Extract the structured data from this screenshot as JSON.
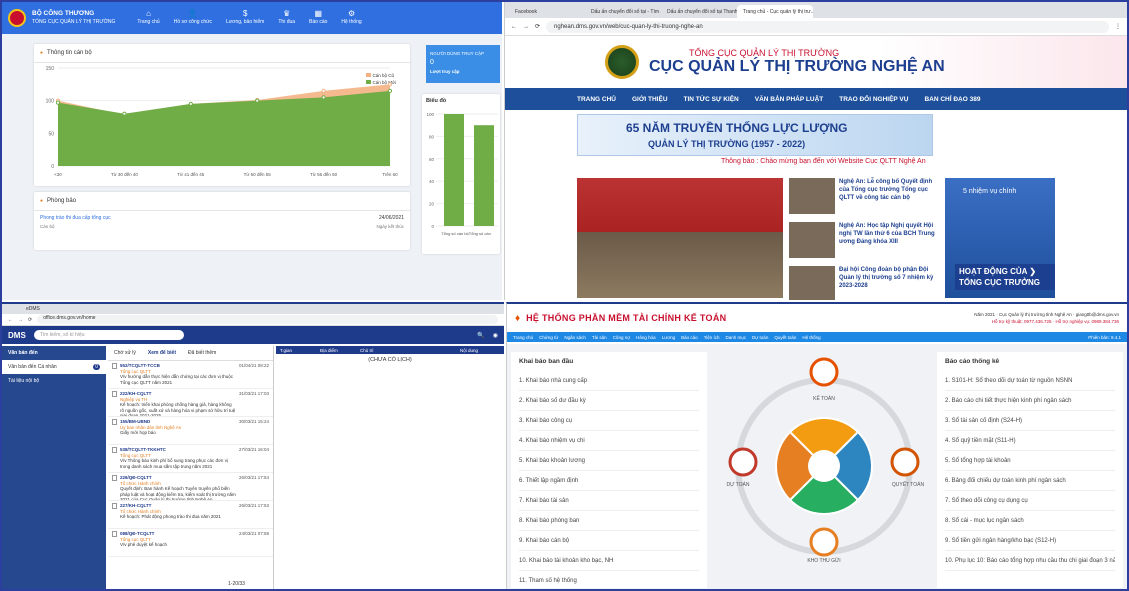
{
  "q1": {
    "brand_title": "BỘ CÔNG THƯƠNG",
    "brand_sub": "TỔNG CỤC QUẢN LÝ THỊ TRƯỜNG",
    "nav": [
      {
        "icon": "⌂",
        "label": "Trang chủ"
      },
      {
        "icon": "👤",
        "label": "Hồ sơ công chức"
      },
      {
        "icon": "$",
        "label": "Lương, bảo hiểm"
      },
      {
        "icon": "♛",
        "label": "Thi đua"
      },
      {
        "icon": "▦",
        "label": "Báo cáo"
      },
      {
        "icon": "⚙",
        "label": "Hệ thống"
      }
    ],
    "info_title": "Thông tin cán bộ",
    "side_title": "NGƯỜI DÙNG TRUY CẬP",
    "side_value": "0",
    "side_sub": "Lượt truy cập",
    "side_chart_title": "Biểu đồ",
    "side_chart_caption": "Tổng số cán bộTổng số cán",
    "notice_title": "Phòng bảo",
    "notice_item": "Phong trào thi đua cấp tổng cục",
    "notice_date": "24/06/2021",
    "notice_org": "Cán bộ",
    "notice_author": "Ngày kết thúc"
  },
  "chart_data": [
    {
      "type": "area",
      "title": "",
      "categories": [
        "<30",
        "Từ 30 đến 40",
        "Từ 41 đến 45",
        "Từ 50 đến 55",
        "Từ 56 đến 60",
        "Trên 60"
      ],
      "ylim": [
        0,
        150
      ],
      "yticks": [
        0,
        50,
        100,
        150
      ],
      "series": [
        {
          "name": "Cán bộ Cũ",
          "color": "#f4b183",
          "values": [
            100,
            78,
            95,
            101,
            115,
            125
          ]
        },
        {
          "name": "Cán bộ Mới",
          "color": "#70ad47",
          "values": [
            97,
            80,
            95,
            100,
            105,
            115
          ]
        }
      ]
    },
    {
      "type": "bar",
      "categories": [
        "Tổng số cán bộ",
        "Tổng số cán"
      ],
      "ylim": [
        0,
        100
      ],
      "yticks": [
        0,
        20,
        40,
        60,
        80,
        100
      ],
      "values": [
        100,
        90
      ]
    }
  ],
  "q2": {
    "tabs": [
      "Facebook",
      "Dấu ấn chuyển đổi số tại - Tìm ...",
      "Dấu ấn chuyển đổi số tại Thanh...",
      "Trang chủ - Cục quản lý thị trư..."
    ],
    "url": "nghean.dms.gov.vn/web/cuc-quan-ly-thi-truong-nghe-an",
    "header_top": "TỔNG CỤC QUẢN LÝ THỊ TRƯỜNG",
    "header_main": "CỤC QUẢN LÝ THỊ TRƯỜNG NGHỆ AN",
    "nav": [
      "TRANG CHỦ",
      "GIỚI THIỆU",
      "TIN TỨC SỰ KIỆN",
      "VĂN BẢN PHÁP LUẬT",
      "TRAO ĐỔI NGHIỆP VỤ",
      "BAN CHỈ ĐẠO 389"
    ],
    "banner_line1": "65 NĂM TRUYỀN THỐNG LỰC LƯỢNG",
    "banner_line2": "QUẢN LÝ THỊ TRƯỜNG (1957 - 2022)",
    "notice": "Thông báo : Chào mừng bạn đến với Website Cục QLTT Nghệ An",
    "news": [
      "Nghệ An: Lễ công bố Quyết định của Tổng cục trưởng Tổng cục QLTT về công tác cán bộ",
      "Nghệ An: Học tập Nghị quyết Hội nghị TW lần thứ 6 của BCH Trung ương Đảng khóa XIII",
      "Đại hội Công đoàn bộ phận Đội Quản lý thị trường số 7 nhiệm kỳ 2023-2028"
    ],
    "promo_title": "5 nhiệm vụ chính",
    "promo_button": "HOẠT ĐỘNG CỦA ❯ TỔNG CỤC TRƯỞNG"
  },
  "q3": {
    "tab": "eDMS",
    "url": "office.dms.gov.vn/home",
    "logo": "DMS",
    "search_placeholder": "Tìm kiếm, số kí hiệu",
    "side": [
      "Văn bản đến",
      "Văn bản đến Cá nhân",
      "Tài liệu nội bộ"
    ],
    "side_badge": "0",
    "list_tabs": [
      "Chờ xử lý",
      "Xem để biết",
      "Đã biết thêm"
    ],
    "grid_headers": [
      "T.gian",
      "Địa điểm",
      "Chủ trì",
      "Nội dung"
    ],
    "grid_empty": "(CHƯA CÓ LỊCH)",
    "pager": "1-20/33",
    "items": [
      {
        "num": "552/TCQLTT-TCCB",
        "org": "Tổng cục QLTT",
        "txt": "V/v hướng dẫn thực hiện dẫn chứng tại các đơn vị thuộc Tổng cục QLTT năm 2021",
        "dt": "01/04/21 08:22"
      },
      {
        "num": "222/KH-CQLTT",
        "org": "Nghiệp vụ TH",
        "txt": "Kế hoạch: triển khai phòng chống hàng giả, hàng không rõ nguồn gốc, xuất xứ và hàng hóa vi phạm sở hữu trí tuệ giai đoạn 2021-2025",
        "dt": "31/03/21 17:03"
      },
      {
        "num": "155/BM-UBND",
        "org": "Ủy ban nhân dân tỉnh Nghệ An",
        "txt": "Giấy mời họp báo",
        "dt": "30/03/21 15:24"
      },
      {
        "num": "538/TCQLTT-TKKHTC",
        "org": "Tổng cục QLTT",
        "txt": "V/v Thông báo kinh phí bổ sung trang phục các đơn vị trong danh sách mua sắm tập trung năm 2021",
        "dt": "27/03/21 16:04"
      },
      {
        "num": "226/QĐ-CQLTT",
        "org": "Tổ chức Hành chính",
        "txt": "Quyết định: Ban hành Kế hoạch Tuyên truyền phổ biến pháp luật và hoạt động kiểm tra, kiểm soát thị trường năm 2021 của Cục Quản lý thị trường tỉnh Nghệ An",
        "dt": "26/03/21 17:54"
      },
      {
        "num": "227/KH-CQLTT",
        "org": "Tổ chức Hành chính",
        "txt": "Kế hoạch: Phát động phong trào thi đua năm 2021",
        "dt": "26/03/21 17:53"
      },
      {
        "num": "088/QĐ-TCQLTT",
        "org": "Tổng cục QLTT",
        "txt": "V/v phê duyệt kế hoạch",
        "dt": "24/03/21 07:59"
      }
    ]
  },
  "q4": {
    "title": "HỆ THỐNG PHẦN MỀM TÀI CHÍNH KẾ TOÁN",
    "year": "Năm 2021",
    "org": "Cục Quản lý thị trường tỉnh Nghệ An",
    "user": "giangttb@dms.gov.vn",
    "hotline1": "Hỗ trợ kỹ thuật: 0977.436.726",
    "hotline2": "Hỗ trợ nghiệp vụ: 0989.384.736",
    "menu": [
      "Trang chủ",
      "Chứng từ",
      "Ngân sách",
      "Tài sản",
      "Công nợ",
      "Hàng hóa",
      "Lương",
      "Báo cáo",
      "Tiện ích",
      "Danh mục",
      "Dự toán",
      "Quyết toán",
      "Hệ thống"
    ],
    "version": "Phiên bản: 9.4.1",
    "left_title": "Khai báo ban đầu",
    "left_items": [
      "1. Khai báo nhà cung cấp",
      "2. Khai báo số dư đầu kỳ",
      "3. Khai báo công cụ",
      "4. Khai báo nhiệm vụ chi",
      "5. Khai báo khoản lương",
      "6. Thiết lập ngầm định",
      "7. Khai báo tài sản",
      "8. Khai báo phòng ban",
      "9. Khai báo cán bộ",
      "10. Khai báo tài khoản kho bạc, NH",
      "11. Tham số hệ thống"
    ],
    "right_title": "Báo cáo thống kê",
    "right_items": [
      "1. S101-H: Sổ theo dõi dự toán từ nguồn NSNN",
      "2. Báo cáo chi tiết thực hiện kinh phí ngân sách",
      "3. Sổ tài sản cố định (S24-H)",
      "4. Sổ quỹ tiền mặt (S11-H)",
      "5. Sổ tổng hợp tài khoản",
      "6. Bảng đối chiếu dự toán kinh phí ngân sách",
      "7. Sổ theo dõi công cụ dụng cụ",
      "8. Sổ cái - mục lục ngân sách",
      "9. Sổ tiền gửi ngân hàng/kho bạc (S12-H)",
      "10. Phụ lục 10: Báo cáo tổng hợp nhu cầu thu chi giai đoạn 3 năm"
    ],
    "labels": {
      "top": "KẾ TOÁN",
      "left": "DỰ TOÁN",
      "right": "QUYẾT TOÁN",
      "bottom": "KHO THU GỬI"
    }
  }
}
